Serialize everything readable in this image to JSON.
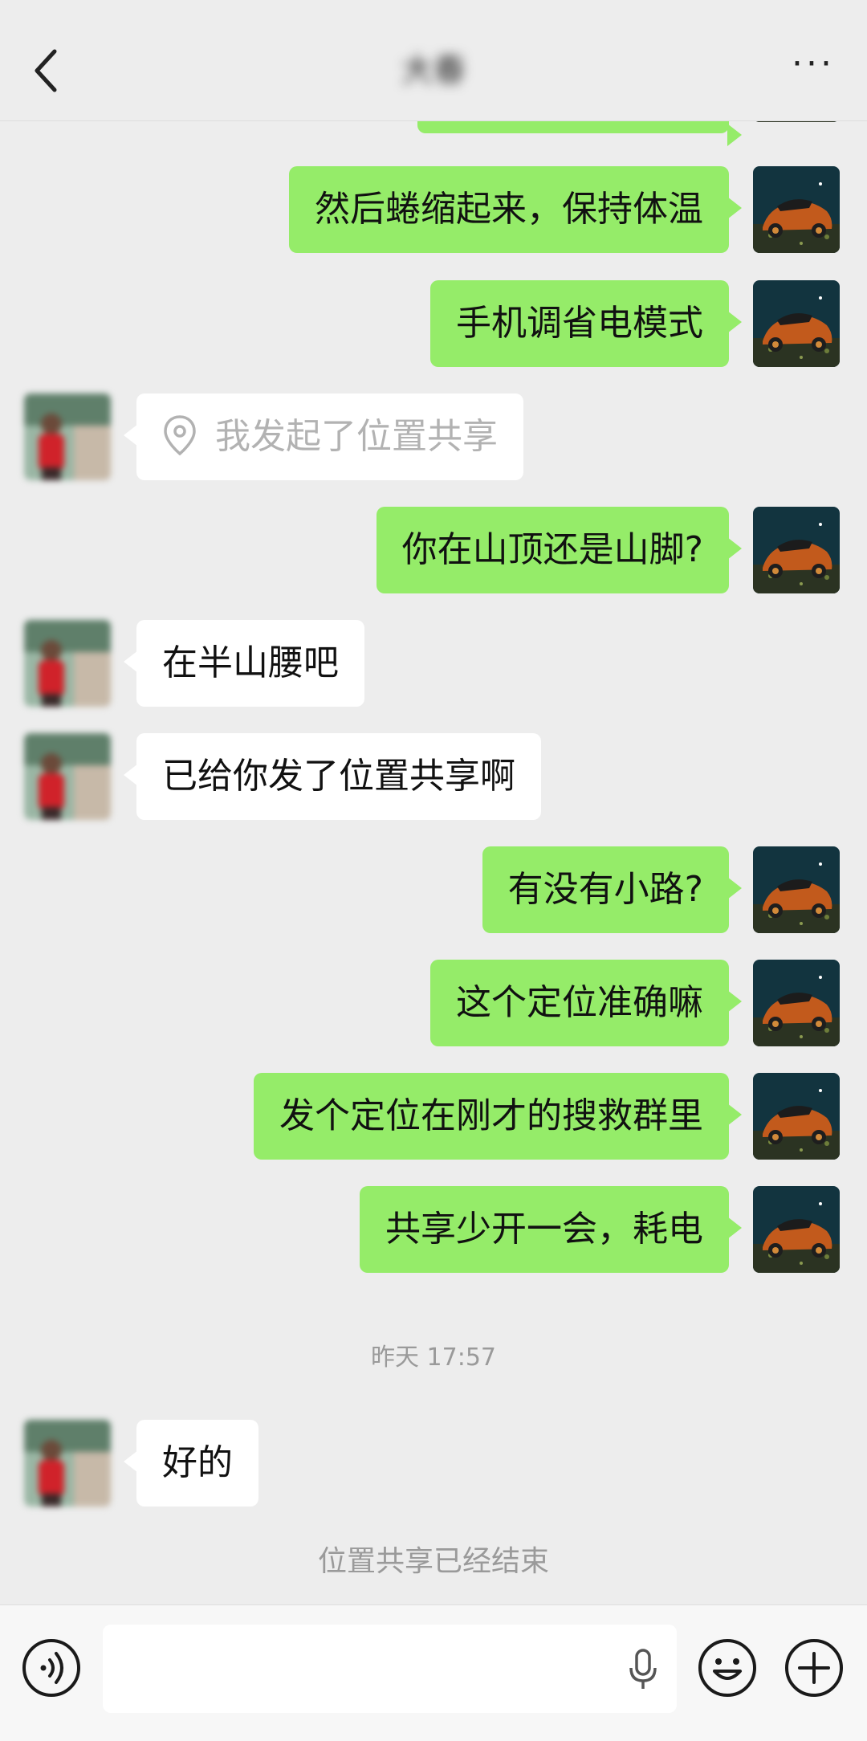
{
  "header": {
    "title": "大春",
    "more_label": "···"
  },
  "messages": [
    {
      "side": "right",
      "text": "然后蜷缩起来，保持体温"
    },
    {
      "side": "right",
      "text": "手机调省电模式"
    },
    {
      "side": "left",
      "text": "我发起了位置共享",
      "kind": "location"
    },
    {
      "side": "right",
      "text": "你在山顶还是山脚?"
    },
    {
      "side": "left",
      "text": "在半山腰吧"
    },
    {
      "side": "left",
      "text": "已给你发了位置共享啊"
    },
    {
      "side": "right",
      "text": "有没有小路?"
    },
    {
      "side": "right",
      "text": "这个定位准确嘛"
    },
    {
      "side": "right",
      "text": "发个定位在刚才的搜救群里"
    },
    {
      "side": "right",
      "text": "共享少开一会，耗电"
    },
    {
      "side": "left",
      "text": "好的"
    }
  ],
  "system": {
    "timestamp": "昨天 17:57",
    "location_ended": "位置共享已经结束"
  },
  "icons": {
    "back": "back-chevron-icon",
    "voice": "voice-mode-icon",
    "mic": "microphone-icon",
    "emoji": "emoji-icon",
    "plus": "plus-icon"
  },
  "colors": {
    "my_bubble": "#95ec69",
    "their_bubble": "#ffffff",
    "background": "#ededed"
  }
}
